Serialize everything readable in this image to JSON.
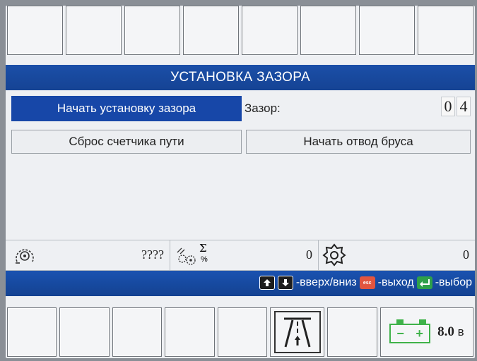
{
  "title": "УСТАНОВКА ЗАЗОРА",
  "actions": {
    "start_gap_setup": "Начать установку зазора",
    "reset_path_counter": "Сброс счетчика пути",
    "start_beam_retract": "Начать отвод бруса"
  },
  "gap": {
    "label": "Зазор:",
    "digit1": "0",
    "digit2": "4"
  },
  "status": {
    "speed_value": "????",
    "slip_value": "0",
    "rotation_value": "0",
    "sigma_symbol": "Σ",
    "percent_symbol": "%"
  },
  "help": {
    "updown_text": "-вверх/вниз",
    "esc_label": "esc",
    "exit_text": "-выход",
    "select_text": "-выбор"
  },
  "battery": {
    "minus": "−",
    "plus": "+",
    "voltage": "8.0",
    "unit": "в"
  },
  "colors": {
    "title_bar": "#154394",
    "active_button": "#1747a8",
    "esc_key": "#e2553f",
    "enter_key": "#2ea04a",
    "battery": "#3fb24a"
  },
  "icons": {
    "speed": "speed-gauge-icon",
    "slip": "slip-gears-icon",
    "rotation": "rotation-gear-icon",
    "up": "arrow-up-icon",
    "down": "arrow-down-icon",
    "road": "road-lane-icon",
    "battery": "battery-icon"
  }
}
